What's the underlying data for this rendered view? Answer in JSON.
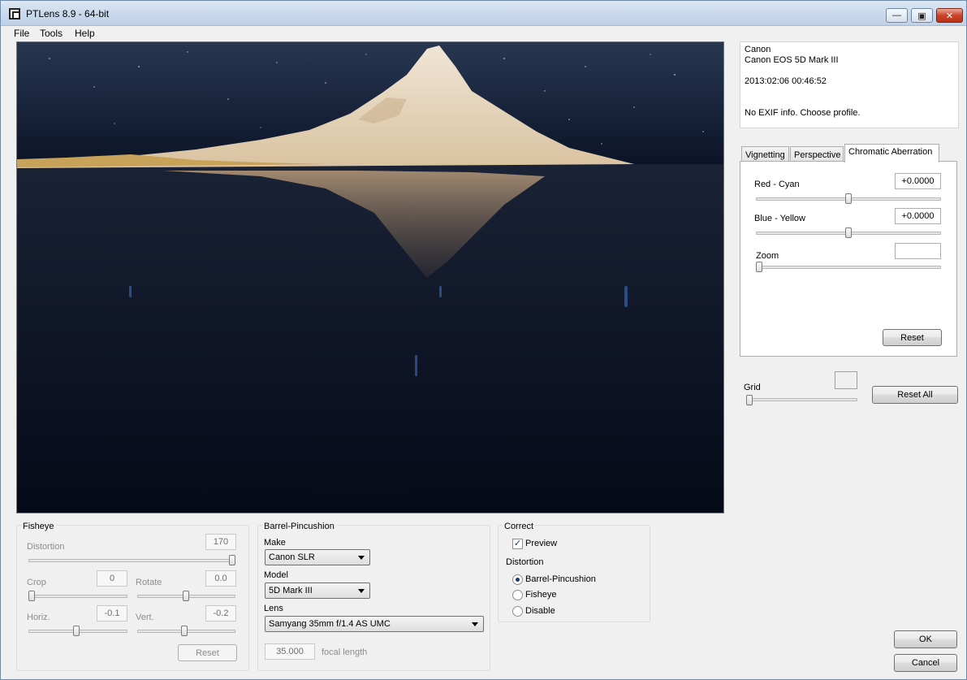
{
  "window": {
    "title": "PTLens 8.9 - 64-bit"
  },
  "menu": {
    "items": [
      "File",
      "Tools",
      "Help"
    ]
  },
  "exif": {
    "make": "Canon",
    "model": "Canon EOS 5D Mark III",
    "datetime": "2013:02:06 00:46:52",
    "message": "No EXIF info. Choose profile."
  },
  "tabs": {
    "items": [
      "Vignetting",
      "Perspective",
      "Chromatic Aberration"
    ],
    "active": "Chromatic Aberration"
  },
  "chromatic": {
    "red_cyan_label": "Red - Cyan",
    "red_cyan_value": "+0.0000",
    "red_cyan_level": 0.5,
    "blue_yellow_label": "Blue - Yellow",
    "blue_yellow_value": "+0.0000",
    "blue_yellow_level": 0.5,
    "zoom_label": "Zoom",
    "zoom_value": "",
    "zoom_level": 0.0,
    "reset_label": "Reset"
  },
  "grid": {
    "label": "Grid",
    "level": 0.0,
    "reset_all_label": "Reset All"
  },
  "fisheye": {
    "title": "Fisheye",
    "distortion_label": "Distortion",
    "distortion_value": "170",
    "distortion_level": 1.0,
    "crop_label": "Crop",
    "crop_value": "0",
    "crop_level": 0.0,
    "rotate_label": "Rotate",
    "rotate_value": "0.0",
    "rotate_level": 0.5,
    "horiz_label": "Horiz.",
    "horiz_value": "-0.1",
    "horiz_level": 0.48,
    "vert_label": "Vert.",
    "vert_value": "-0.2",
    "vert_level": 0.46,
    "reset_label": "Reset"
  },
  "barrel": {
    "title": "Barrel-Pincushion",
    "make_label": "Make",
    "make_value": "Canon SLR",
    "model_label": "Model",
    "model_value": "5D Mark III",
    "lens_label": "Lens",
    "lens_value": "Samyang 35mm f/1.4 AS UMC",
    "focal_value": "35.000",
    "focal_label": "focal length"
  },
  "correct": {
    "title": "Correct",
    "preview_label": "Preview",
    "preview_checked": true,
    "distortion_label": "Distortion",
    "options": [
      "Barrel-Pincushion",
      "Fisheye",
      "Disable"
    ],
    "selected": "Barrel-Pincushion"
  },
  "dialog": {
    "ok_label": "OK",
    "cancel_label": "Cancel"
  },
  "colors": {
    "accent": "#1a3a6e",
    "sky": "#1c2a44",
    "mountain": "#e8d8c2",
    "shore": "#c9a25a"
  }
}
